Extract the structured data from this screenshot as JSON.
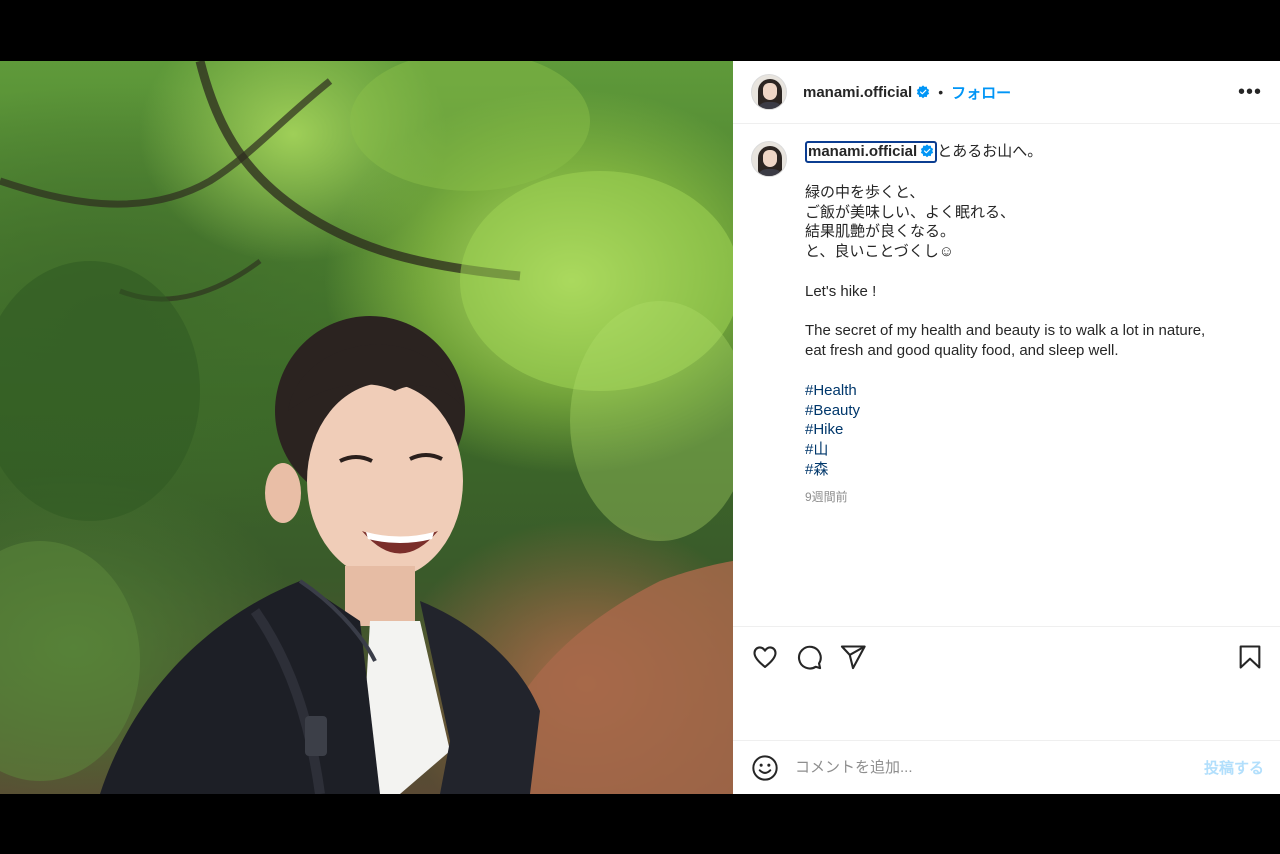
{
  "post": {
    "username": "manami.official",
    "follow_label": "フォロー",
    "separator": "•",
    "more_label": "•••"
  },
  "caption": {
    "username": "manami.official",
    "first_line": "とあるお山へ。",
    "lines": [
      "緑の中を歩くと、",
      "ご飯が美味しい、よく眠れる、",
      "結果肌艶が良くなる。",
      "と、良いことづくし☺",
      "",
      "Let's hike !",
      "",
      "The secret of my health and beauty is to walk a lot in nature,",
      "eat fresh and good quality food, and sleep well.",
      ""
    ],
    "hashtags": [
      "#Health",
      "#Beauty",
      "#Hike",
      "#山",
      "#森"
    ],
    "time": "9週間前"
  },
  "comment": {
    "placeholder": "コメントを追加...",
    "post_label": "投稿する"
  },
  "icons": {
    "like": "heart-icon",
    "comment": "comment-icon",
    "share": "send-icon",
    "save": "bookmark-icon",
    "emoji": "emoji-icon",
    "verified": "verified-badge-icon"
  },
  "colors": {
    "accent": "#0095f6",
    "hashtag": "#00376b",
    "muted": "#8e8e8e"
  }
}
